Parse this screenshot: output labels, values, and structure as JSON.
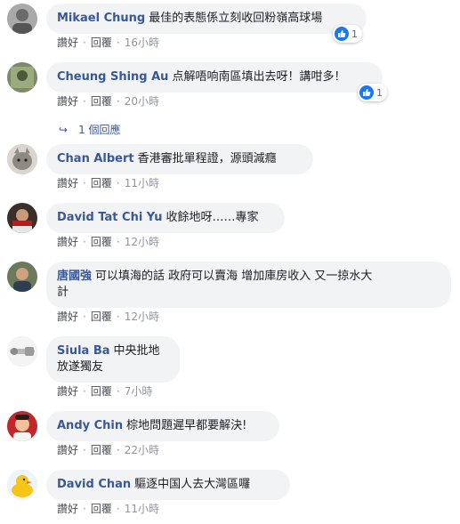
{
  "actions": {
    "like": "讚好",
    "reply": "回覆",
    "dot": "·"
  },
  "comments": [
    {
      "name": "Mikael Chung",
      "text": "最佳的表態係立刻收回粉嶺高球場",
      "time": "16小時",
      "reactions": "1"
    },
    {
      "name": "Cheung Shing Au",
      "text": "点解唔响南區填出去呀！講咁多！",
      "time": "20小時",
      "reactions": "1"
    },
    {
      "name": "Chan Albert",
      "text": "香港審批單程證，源頭減癮",
      "time": "11小時"
    },
    {
      "name": "David Tat Chi Yu",
      "text": "收餘地呀……專家",
      "time": "12小時"
    },
    {
      "name": "唐國強",
      "text_line1": "可以填海的話 政府可以賣海 增加庫房收入 又一掠水大",
      "text_line2": "計",
      "time": "12小時"
    },
    {
      "name": "Siula Ba",
      "text_line1": "中央批地",
      "text_line2": "放遂獨友",
      "time": "7小時"
    },
    {
      "name": "Andy Chin",
      "text": "棕地問題遲早都要解決!",
      "time": "22小時"
    },
    {
      "name": "David Chan",
      "text": "驅逐中国人去大灣區囉",
      "time": "11小時"
    }
  ],
  "replies": {
    "arrow": "↪",
    "label": "1 個回應"
  },
  "colors": {
    "name": "#385898",
    "bubble": "#f2f3f5",
    "like": "#1877f2",
    "meta": "#90949c"
  }
}
